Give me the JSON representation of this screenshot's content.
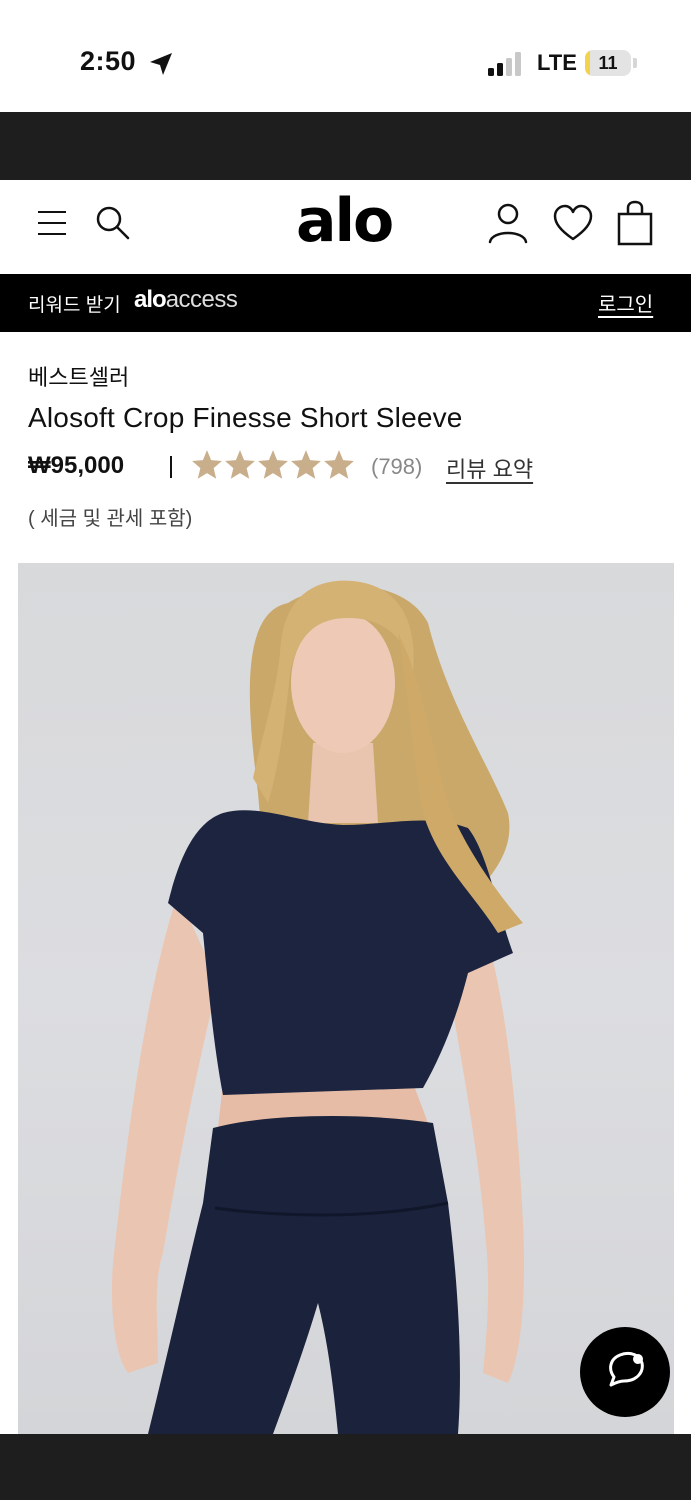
{
  "status_bar": {
    "time": "2:50",
    "network": "LTE",
    "battery_level": "11",
    "battery_fraction": 0.11,
    "icons": [
      "location-arrow-icon",
      "signal-bars-icon",
      "battery-icon"
    ]
  },
  "header": {
    "logo": "alo",
    "icons": [
      "menu-icon",
      "search-icon",
      "account-icon",
      "heart-icon",
      "shopping-bag-icon"
    ]
  },
  "promo_bar": {
    "text": "리워드 받기",
    "brand_part1": "alo",
    "brand_part2": "access",
    "login_label": "로그인"
  },
  "product": {
    "badge": "베스트셀러",
    "title": "Alosoft Crop Finesse Short Sleeve",
    "price": "₩95,000",
    "rating": 5,
    "rating_max": 5,
    "review_count": "(798)",
    "review_summary_label": "리뷰 요약",
    "tax_note": "( 세금 및 관세 포함)",
    "star_color": "#c9ae8c"
  },
  "chat": {
    "icon": "chat-bubble-icon"
  },
  "colors": {
    "dark_strip": "#1e1e1e",
    "promo_bg": "#000000",
    "image_bg": "#d8d9db",
    "garment": "#1c2440"
  }
}
